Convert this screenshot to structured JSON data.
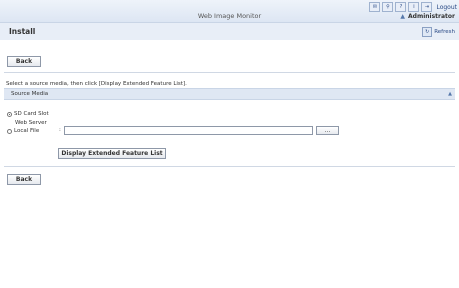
{
  "header": {
    "app_title": "Web Image Monitor",
    "user": "Administrator",
    "logout_label": "Logout",
    "icons": [
      "mail-icon",
      "search-icon",
      "help-icon",
      "info-icon",
      "logout-icon"
    ]
  },
  "page": {
    "title": "Install",
    "refresh_label": "Refresh"
  },
  "buttons": {
    "back_top": "Back",
    "back_bottom": "Back",
    "display_list": "Display Extended Feature List",
    "browse": "..."
  },
  "instruction": "Select a source media, then click [Display Extended Feature List].",
  "section": {
    "title": "Source Media"
  },
  "source_media": {
    "options": [
      {
        "label": "SD Card Slot",
        "selected": true
      },
      {
        "label": "Local File",
        "selected": false
      }
    ],
    "sub_label": "Web Server",
    "local_file_separator": ":",
    "local_file_value": ""
  }
}
